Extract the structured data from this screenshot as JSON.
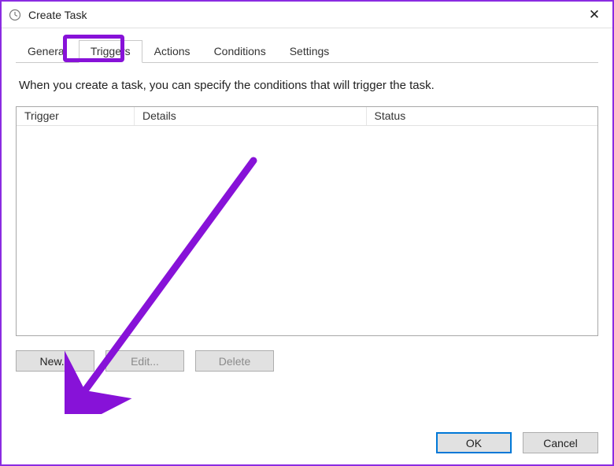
{
  "window": {
    "title": "Create Task",
    "close_glyph": "✕"
  },
  "tabs": [
    {
      "label": "General"
    },
    {
      "label": "Triggers"
    },
    {
      "label": "Actions"
    },
    {
      "label": "Conditions"
    },
    {
      "label": "Settings"
    }
  ],
  "active_tab_index": 1,
  "description": "When you create a task, you can specify the conditions that will trigger the task.",
  "table": {
    "columns": {
      "trigger": "Trigger",
      "details": "Details",
      "status": "Status"
    }
  },
  "buttons": {
    "new": "New...",
    "edit": "Edit...",
    "delete": "Delete",
    "ok": "OK",
    "cancel": "Cancel"
  },
  "annotation": {
    "highlight_tab": "Triggers",
    "arrow_color": "#8712d8"
  }
}
